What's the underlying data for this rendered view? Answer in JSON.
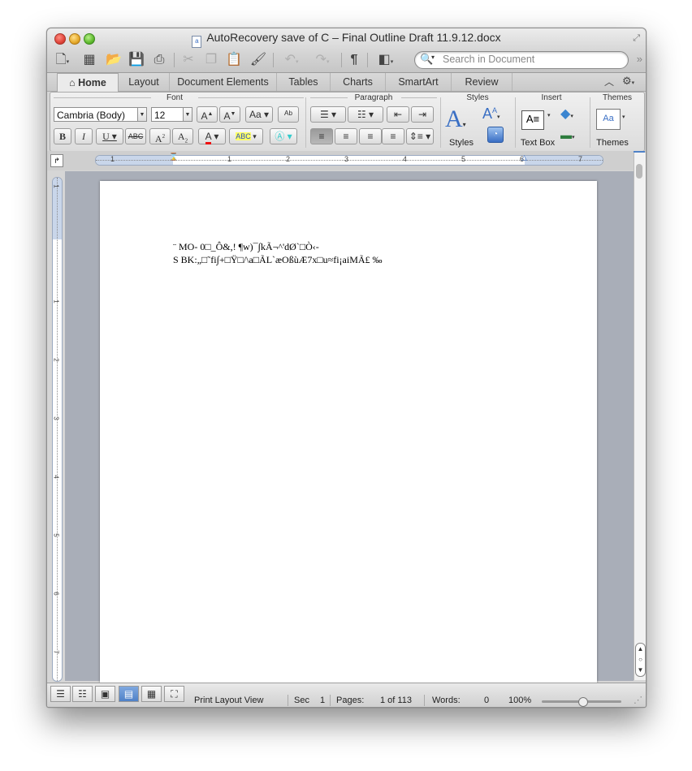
{
  "window": {
    "title": "AutoRecovery save of C – Final Outline Draft 11.9.12.docx"
  },
  "toolbar": {
    "search_placeholder": "Search in Document",
    "paragraph_mark": "¶"
  },
  "tabs": [
    "Home",
    "Layout",
    "Document Elements",
    "Tables",
    "Charts",
    "SmartArt",
    "Review"
  ],
  "ribbon": {
    "groups": {
      "font": "Font",
      "paragraph": "Paragraph",
      "styles": "Styles",
      "insert": "Insert",
      "themes": "Themes"
    },
    "font_name": "Cambria (Body)",
    "font_size": "12",
    "styles_label": "Styles",
    "textbox_label": "Text Box",
    "themes_label": "Themes"
  },
  "ruler": {
    "h_labels": [
      "1",
      "1",
      "2",
      "3",
      "4",
      "5",
      "6",
      "7"
    ],
    "v_labels": [
      "1",
      "1",
      "2",
      "3",
      "4",
      "5",
      "6",
      "7"
    ]
  },
  "document": {
    "line1": "¨ MO- 0□_Ô&,! ¶w)¯∫kÃ¬^'dØ`□Ò‹-",
    "line2": "S BK:„□˜fi∫+□Ÿ□/\\a□ÃL`æOßùÆ7x□u≈fi¡aiMÃ£ ‰"
  },
  "status": {
    "view": "Print Layout View",
    "sec_label": "Sec",
    "sec_value": "1",
    "pages_label": "Pages:",
    "pages_value": "1 of 113",
    "words_label": "Words:",
    "words_value": "0",
    "zoom": "100%"
  },
  "colors": {
    "accent": "#4f81c7",
    "ribbon_bg": "#e6e6e6",
    "workspace_bg": "#a9aeb8"
  }
}
